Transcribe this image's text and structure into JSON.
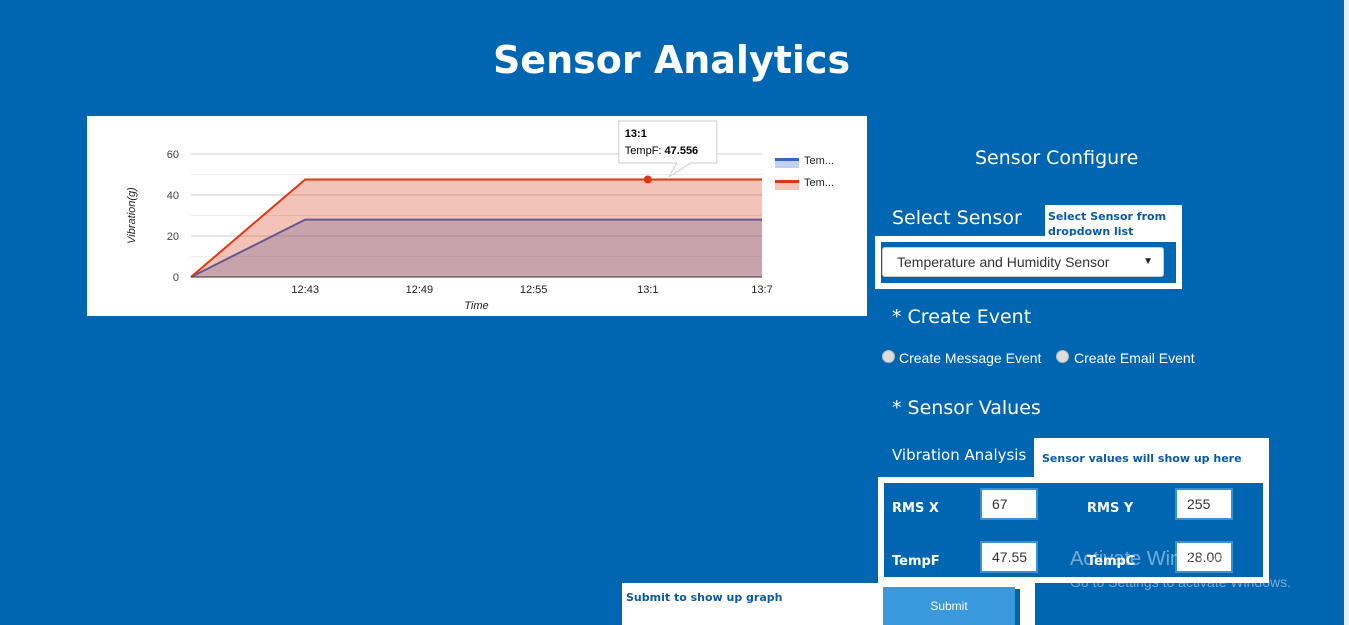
{
  "page": {
    "title": "Sensor Analytics"
  },
  "chart_data": {
    "type": "area",
    "xlabel": "Time",
    "ylabel": "Vibration(g)",
    "x": [
      "",
      "12:43",
      "12:49",
      "12:55",
      "13:1",
      "13:7"
    ],
    "x_ticks": [
      "12:43",
      "12:49",
      "12:55",
      "13:1",
      "13:7"
    ],
    "y_ticks": [
      0,
      20,
      40,
      60
    ],
    "ylim": [
      0,
      60
    ],
    "grid": true,
    "legend_placement": "right",
    "series": [
      {
        "name": "Tem...",
        "color": "#3366cc",
        "values": [
          0,
          28,
          28,
          28,
          28,
          28
        ]
      },
      {
        "name": "Tem...",
        "color": "#dc3912",
        "values": [
          0,
          47.556,
          47.556,
          47.556,
          47.556,
          47.556
        ]
      }
    ],
    "tooltip": {
      "title": "13:1",
      "label": "TempF: ",
      "value": "47.556"
    }
  },
  "config": {
    "heading": "Sensor Configure",
    "select_sensor_label": "Select Sensor",
    "select_sensor_note": "Select Sensor from dropdown list",
    "sensor_selected": "Temperature and Humidity Sensor",
    "create_event_heading": "* Create Event",
    "radio_message": "Create Message Event",
    "radio_email": "Create Email Event",
    "sensor_values_heading": "* Sensor Values",
    "vibration_label": "Vibration Analysis",
    "values_note": "Sensor values will show up here",
    "fields": {
      "rms_x": {
        "label": "RMS X",
        "value": "67"
      },
      "rms_y": {
        "label": "RMS Y",
        "value": "255"
      },
      "temp_f": {
        "label": "TempF",
        "value": "47.55"
      },
      "temp_c": {
        "label": "TempC",
        "value": "28.00"
      }
    },
    "submit_note": "Submit to show up graph",
    "submit_label": "Submit"
  },
  "watermark": {
    "line1": "Activate Windows",
    "line2": "Go to Settings to activate Windows."
  },
  "colors": {
    "background": "#0066b2",
    "series1": "#3366cc",
    "series2": "#dc3912"
  }
}
